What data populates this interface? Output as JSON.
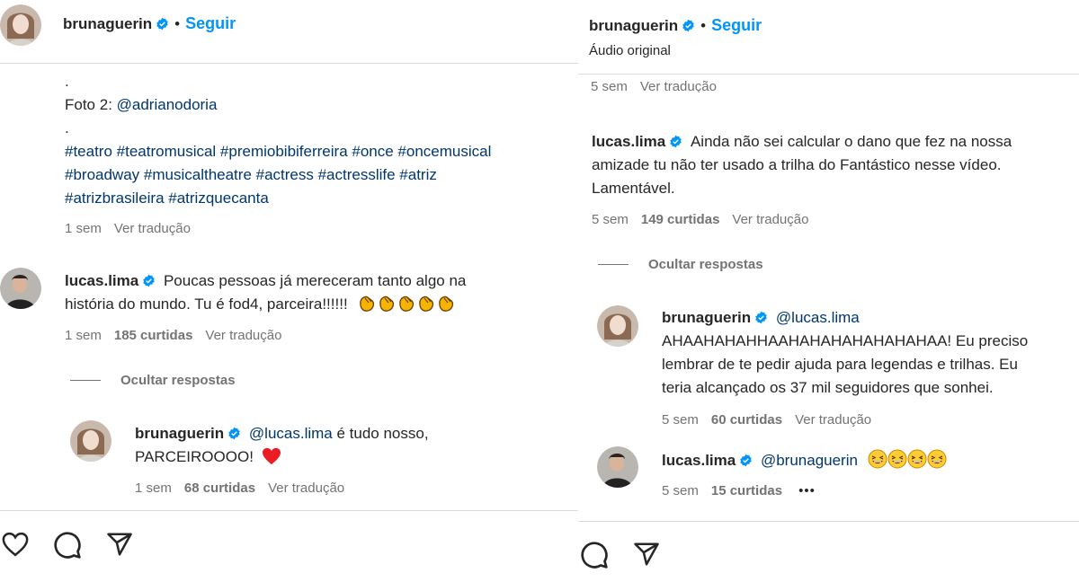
{
  "left": {
    "header": {
      "username": "brunaguerin",
      "follow": "Seguir"
    },
    "caption": {
      "dot1": ".",
      "photo_label": "Foto 2: ",
      "photo_mention": "@adrianodoria",
      "dot2": ".",
      "hashtags_line1": "#teatro #teatromusical #premiobibiferreira #once #oncemusical",
      "hashtags_line2": "#broadway #musicaltheatre #actress #actresslife #atriz",
      "hashtags_line3": "#atrizbrasileira #atrizquecanta",
      "time": "1 sem",
      "translate": "Ver tradução"
    },
    "comment": {
      "username": "lucas.lima",
      "text_line1": "Poucas pessoas já mereceram tanto algo na",
      "text_line2": "história do mundo. Tu é fod4, parceira!!!!!!",
      "time": "1 sem",
      "likes": "185 curtidas",
      "translate": "Ver tradução"
    },
    "hide_replies": "Ocultar respostas",
    "reply": {
      "username": "brunaguerin",
      "mention": "@lucas.lima",
      "text_line1": " é tudo nosso,",
      "text_line2": "PARCEIROOOO!",
      "time": "1 sem",
      "likes": "68 curtidas",
      "translate": "Ver tradução"
    }
  },
  "right": {
    "header": {
      "username": "brunaguerin",
      "follow": "Seguir",
      "subtitle": "Áudio original"
    },
    "top_meta": {
      "time": "5 sem",
      "translate": "Ver tradução"
    },
    "comment": {
      "username": "lucas.lima",
      "text_line1": "Ainda não sei calcular o dano que fez na nossa",
      "text_line2": "amizade tu não ter usado a trilha do Fantástico nesse vídeo.",
      "text_line3": "Lamentável.",
      "time": "5 sem",
      "likes": "149 curtidas",
      "translate": "Ver tradução"
    },
    "hide_replies": "Ocultar respostas",
    "reply1": {
      "username": "brunaguerin",
      "mention": "@lucas.lima",
      "text_line1": "AHAAHAHAHHAAHAHAHAHAHAHAHAA! Eu preciso",
      "text_line2": "lembrar de te pedir ajuda para legendas e trilhas. Eu",
      "text_line3": "teria alcançado os 37 mil seguidores que sonhei.",
      "time": "5 sem",
      "likes": "60 curtidas",
      "translate": "Ver tradução"
    },
    "reply2": {
      "username": "lucas.lima",
      "mention": "@brunaguerin",
      "time": "5 sem",
      "likes": "15 curtidas",
      "more": "•••"
    }
  },
  "colors": {
    "accent": "#0095f6",
    "link": "#00376b",
    "meta": "#737373",
    "verified": "#0095f6",
    "heart": "#ed1c24"
  },
  "icons": [
    "heart-icon",
    "comment-icon",
    "share-icon",
    "verified-badge-icon",
    "clap-emoji",
    "laughing-emoji",
    "red-heart-emoji",
    "more-icon"
  ]
}
